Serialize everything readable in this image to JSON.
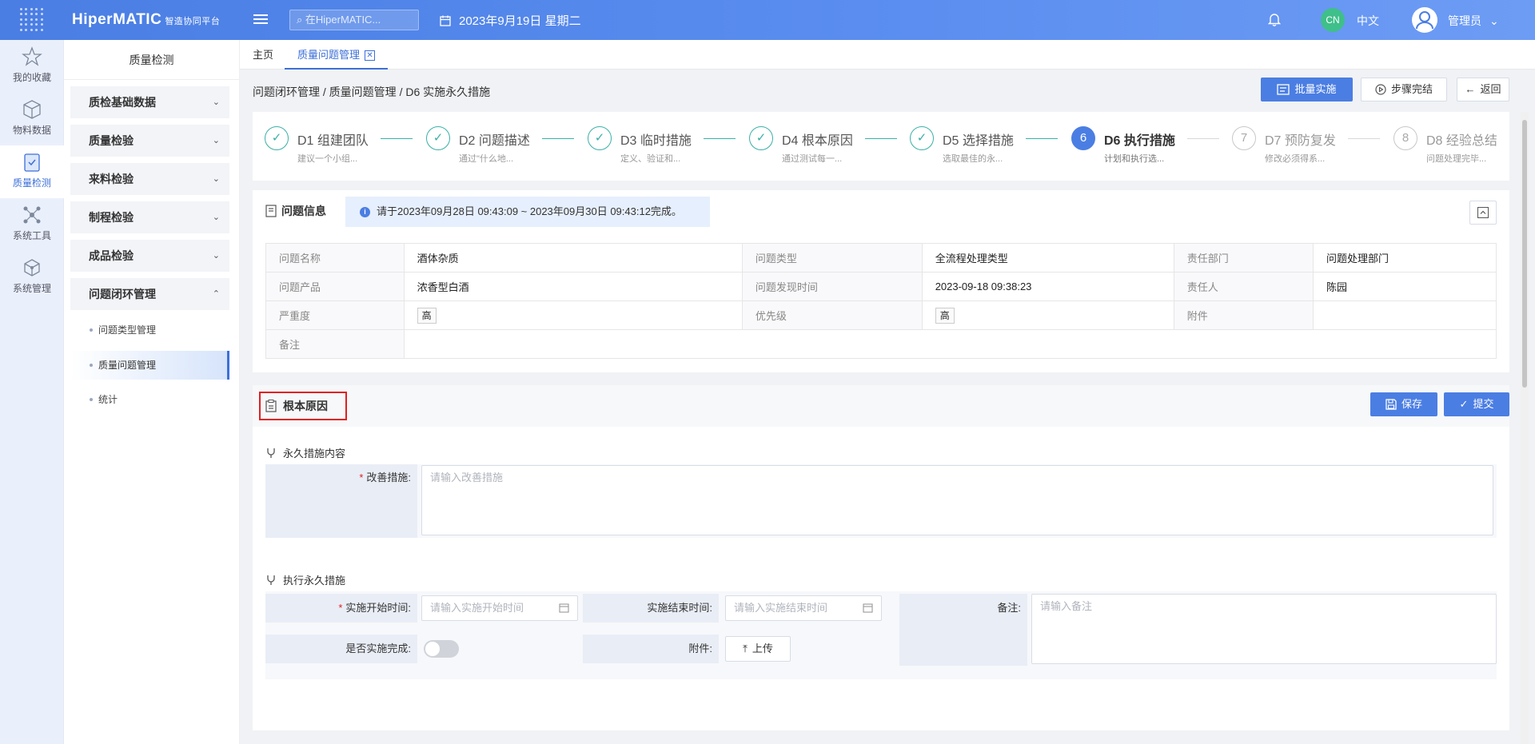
{
  "topbar": {
    "brand": "HiperMATIC",
    "brand_sub": "智造协同平台",
    "search_placeholder": "在HiperMATIC...",
    "date": "2023年9月19日 星期二",
    "lang_badge": "CN",
    "lang": "中文",
    "user": "管理员"
  },
  "rail": {
    "items": [
      {
        "label": "我的收藏",
        "icon": "star-icon"
      },
      {
        "label": "物料数据",
        "icon": "cube-icon"
      },
      {
        "label": "质量检测",
        "icon": "shield-check-icon"
      },
      {
        "label": "系统工具",
        "icon": "network-icon"
      },
      {
        "label": "系统管理",
        "icon": "box-icon"
      }
    ]
  },
  "sidebar": {
    "title": "质量检测",
    "groups": [
      "质检基础数据",
      "质量检验",
      "来料检验",
      "制程检验",
      "成品检验",
      "问题闭环管理"
    ],
    "subs": [
      "问题类型管理",
      "质量问题管理",
      "统计"
    ]
  },
  "tabs": {
    "home": "主页",
    "current": "质量问题管理"
  },
  "breadcrumb": {
    "a": "问题闭环管理",
    "b": "质量问题管理",
    "c": "D6 实施永久措施",
    "sep": "/"
  },
  "actions": {
    "batch": "批量实施",
    "step_done": "步骤完结",
    "back": "返回"
  },
  "steps": [
    {
      "num": "✓",
      "title": "D1 组建团队",
      "desc": "建议一个小组..."
    },
    {
      "num": "✓",
      "title": "D2 问题描述",
      "desc": "通过\"什么地..."
    },
    {
      "num": "✓",
      "title": "D3 临时措施",
      "desc": "定义、验证和..."
    },
    {
      "num": "✓",
      "title": "D4 根本原因",
      "desc": "通过测试每一..."
    },
    {
      "num": "✓",
      "title": "D5 选择措施",
      "desc": "选取最佳的永..."
    },
    {
      "num": "6",
      "title": "D6 执行措施",
      "desc": "计划和执行选..."
    },
    {
      "num": "7",
      "title": "D7 预防复发",
      "desc": "修改必须得系..."
    },
    {
      "num": "8",
      "title": "D8 经验总结",
      "desc": "问题处理完毕..."
    }
  ],
  "info": {
    "title": "问题信息",
    "notice": "请于2023年09月28日 09:43:09 ~ 2023年09月30日 09:43:12完成。",
    "rows": [
      [
        "问题名称",
        "酒体杂质",
        "问题类型",
        "全流程处理类型",
        "责任部门",
        "问题处理部门"
      ],
      [
        "问题产品",
        "浓香型白酒",
        "问题发现时间",
        "2023-09-18 09:38:23",
        "责任人",
        "陈园"
      ],
      [
        "严重度",
        "高",
        "优先级",
        "高",
        "附件",
        ""
      ],
      [
        "备注",
        ""
      ]
    ]
  },
  "rootcause": {
    "title": "根本原因",
    "save": "保存",
    "submit": "提交",
    "sec1": "永久措施内容",
    "improve_label": "改善措施:",
    "improve_ph": "请输入改善措施",
    "sec2": "执行永久措施",
    "start_label": "实施开始时间:",
    "start_ph": "请输入实施开始时间",
    "end_label": "实施结束时间:",
    "end_ph": "请输入实施结束时间",
    "remark_label": "备注:",
    "remark_ph": "请输入备注",
    "done_label": "是否实施完成:",
    "attach_label": "附件:",
    "upload": "上传",
    "done_value": false
  }
}
